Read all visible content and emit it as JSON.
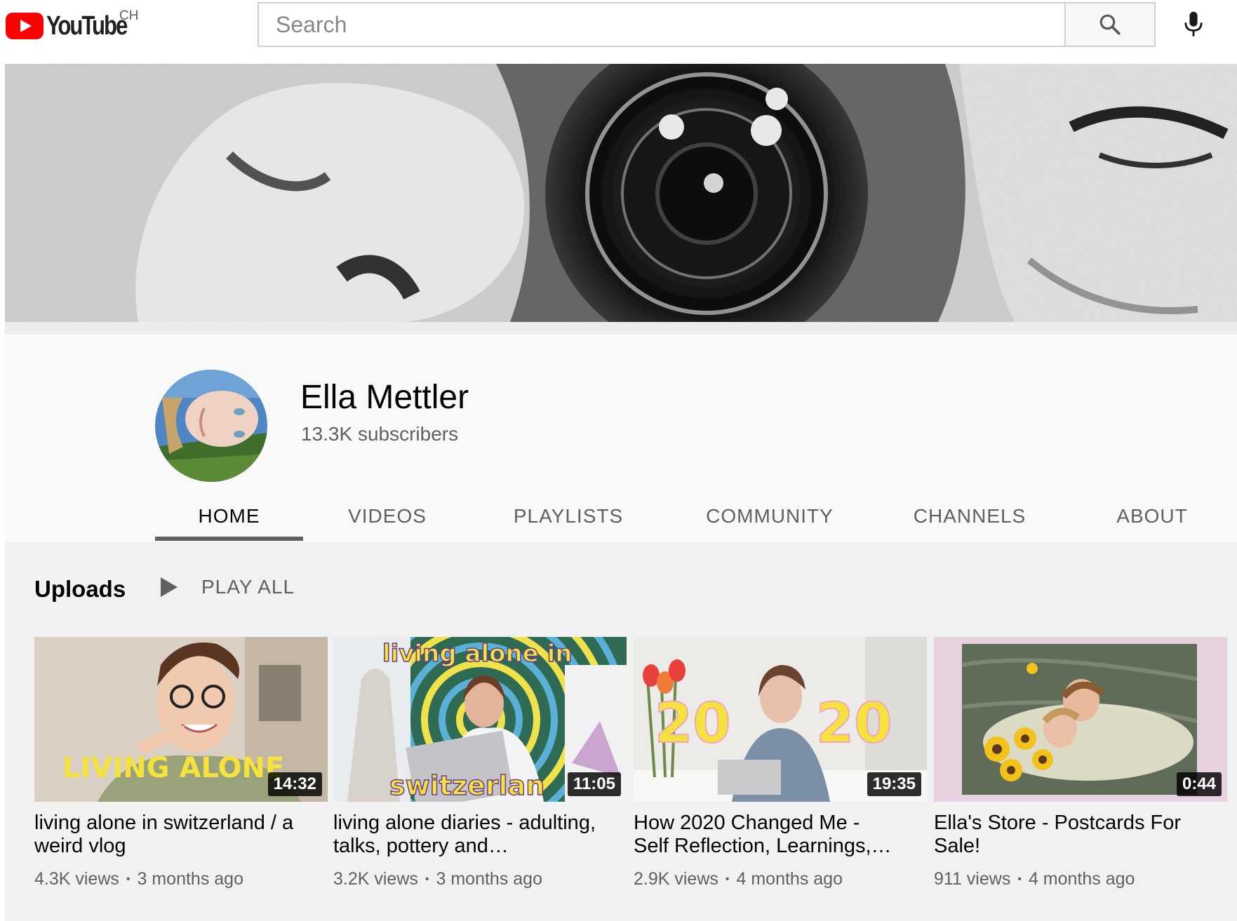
{
  "header": {
    "logo_text": "YouTube",
    "country_code": "CH",
    "search_placeholder": "Search"
  },
  "channel": {
    "name": "Ella Mettler",
    "subscribers": "13.3K subscribers"
  },
  "tabs": [
    {
      "label": "HOME",
      "active": true
    },
    {
      "label": "VIDEOS"
    },
    {
      "label": "PLAYLISTS"
    },
    {
      "label": "COMMUNITY"
    },
    {
      "label": "CHANNELS"
    },
    {
      "label": "ABOUT"
    }
  ],
  "shelf": {
    "title": "Uploads",
    "play_all": "PLAY ALL"
  },
  "videos": [
    {
      "title": "living alone in switzerland / a weird vlog",
      "duration": "14:32",
      "views": "4.3K views",
      "age": "3 months ago",
      "thumb_text": "LIVING ALONE"
    },
    {
      "title": "living alone diaries - adulting, talks, pottery and…",
      "duration": "11:05",
      "views": "3.2K views",
      "age": "3 months ago",
      "thumb_text_top": "living alone in",
      "thumb_text_bottom": "switzerlan"
    },
    {
      "title": "How 2020 Changed Me - Self Reflection, Learnings,…",
      "duration": "19:35",
      "views": "2.9K views",
      "age": "4 months ago",
      "thumb_text_left": "20",
      "thumb_text_right": "20"
    },
    {
      "title": "Ella's Store - Postcards For Sale!",
      "duration": "0:44",
      "views": "911 views",
      "age": "4 months ago"
    }
  ],
  "colors": {
    "brand_red": "#ff0000",
    "text_primary": "#030303",
    "text_secondary": "#606060",
    "thumb_yellow": "#f5e23c"
  }
}
